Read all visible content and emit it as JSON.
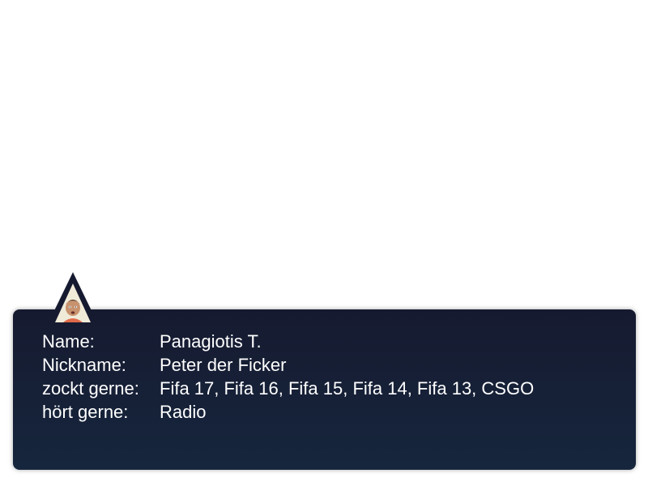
{
  "profile": {
    "avatar_icon": "user-portrait-triangle",
    "accent_color": "#161a30",
    "fields": [
      {
        "label": "Name:",
        "value": "Panagiotis T."
      },
      {
        "label": "Nickname:",
        "value": "Peter der Ficker"
      },
      {
        "label": "zockt gerne:",
        "value": "Fifa 17, Fifa 16, Fifa 15, Fifa 14, Fifa 13, CSGO"
      },
      {
        "label": "hört gerne:",
        "value": "Radio"
      }
    ]
  }
}
